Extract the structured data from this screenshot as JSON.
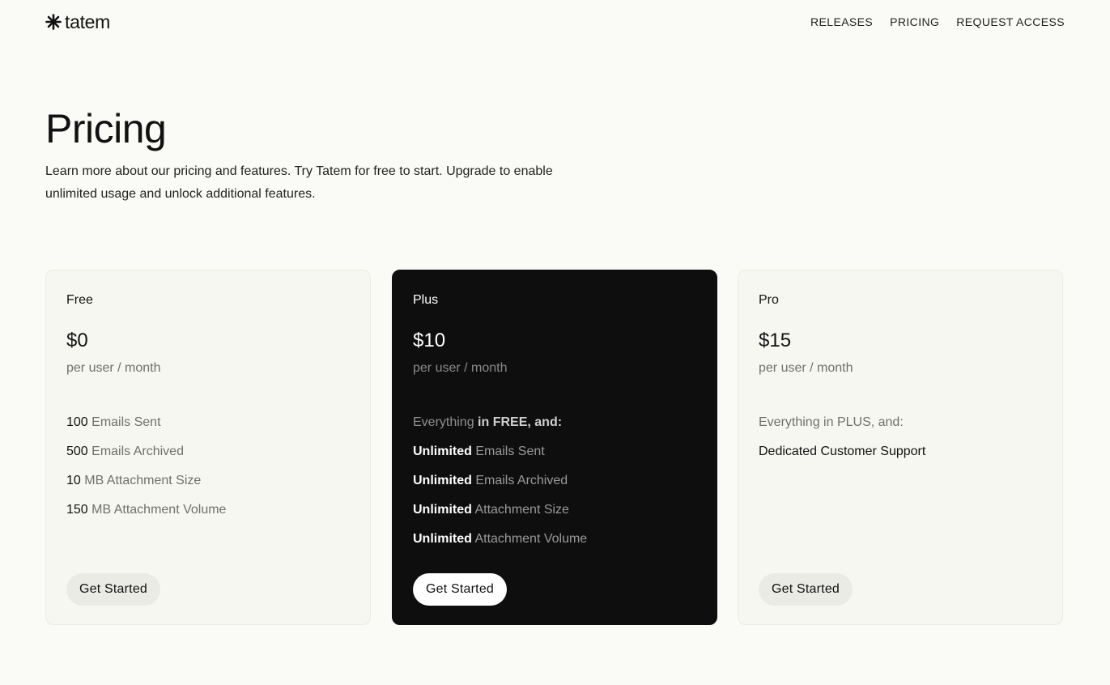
{
  "header": {
    "brand": "tatem",
    "nav": [
      "RELEASES",
      "PRICING",
      "REQUEST ACCESS"
    ]
  },
  "hero": {
    "title": "Pricing",
    "intro": "Learn more about our pricing and features. Try Tatem for free to start. Upgrade to enable unlimited usage and unlock additional features."
  },
  "plans": [
    {
      "name": "Free",
      "price": "$0",
      "period": "per user / month",
      "features": [
        {
          "strong": "100",
          "rest": " Emails Sent"
        },
        {
          "strong": "500",
          "rest": " Emails Archived"
        },
        {
          "strong": "10",
          "rest": " MB Attachment Size"
        },
        {
          "strong": "150",
          "rest": " MB Attachment Volume"
        }
      ],
      "cta": "Get Started"
    },
    {
      "name": "Plus",
      "price": "$10",
      "period": "per user / month",
      "lead": {
        "pre": "Everything",
        "strong": " in FREE, and:"
      },
      "features": [
        {
          "strong": "Unlimited",
          "rest": " Emails Sent"
        },
        {
          "strong": "Unlimited",
          "rest": " Emails Archived"
        },
        {
          "strong": "Unlimited",
          "rest": " Attachment Size"
        },
        {
          "strong": "Unlimited",
          "rest": " Attachment Volume"
        }
      ],
      "cta": "Get Started"
    },
    {
      "name": "Pro",
      "price": "$15",
      "period": "per user / month",
      "lead": "Everything in PLUS, and:",
      "features": [
        "Dedicated Customer Support"
      ],
      "cta": "Get Started"
    }
  ],
  "colors": {
    "page_background": "#fafaf6",
    "card_background": "#f7f7f1",
    "featured_card_background": "#0e0e0e",
    "muted_text": "#6f6f6f",
    "button_background": "#ebebe6"
  },
  "icons": {
    "brand": "asterisk-logo-icon"
  }
}
